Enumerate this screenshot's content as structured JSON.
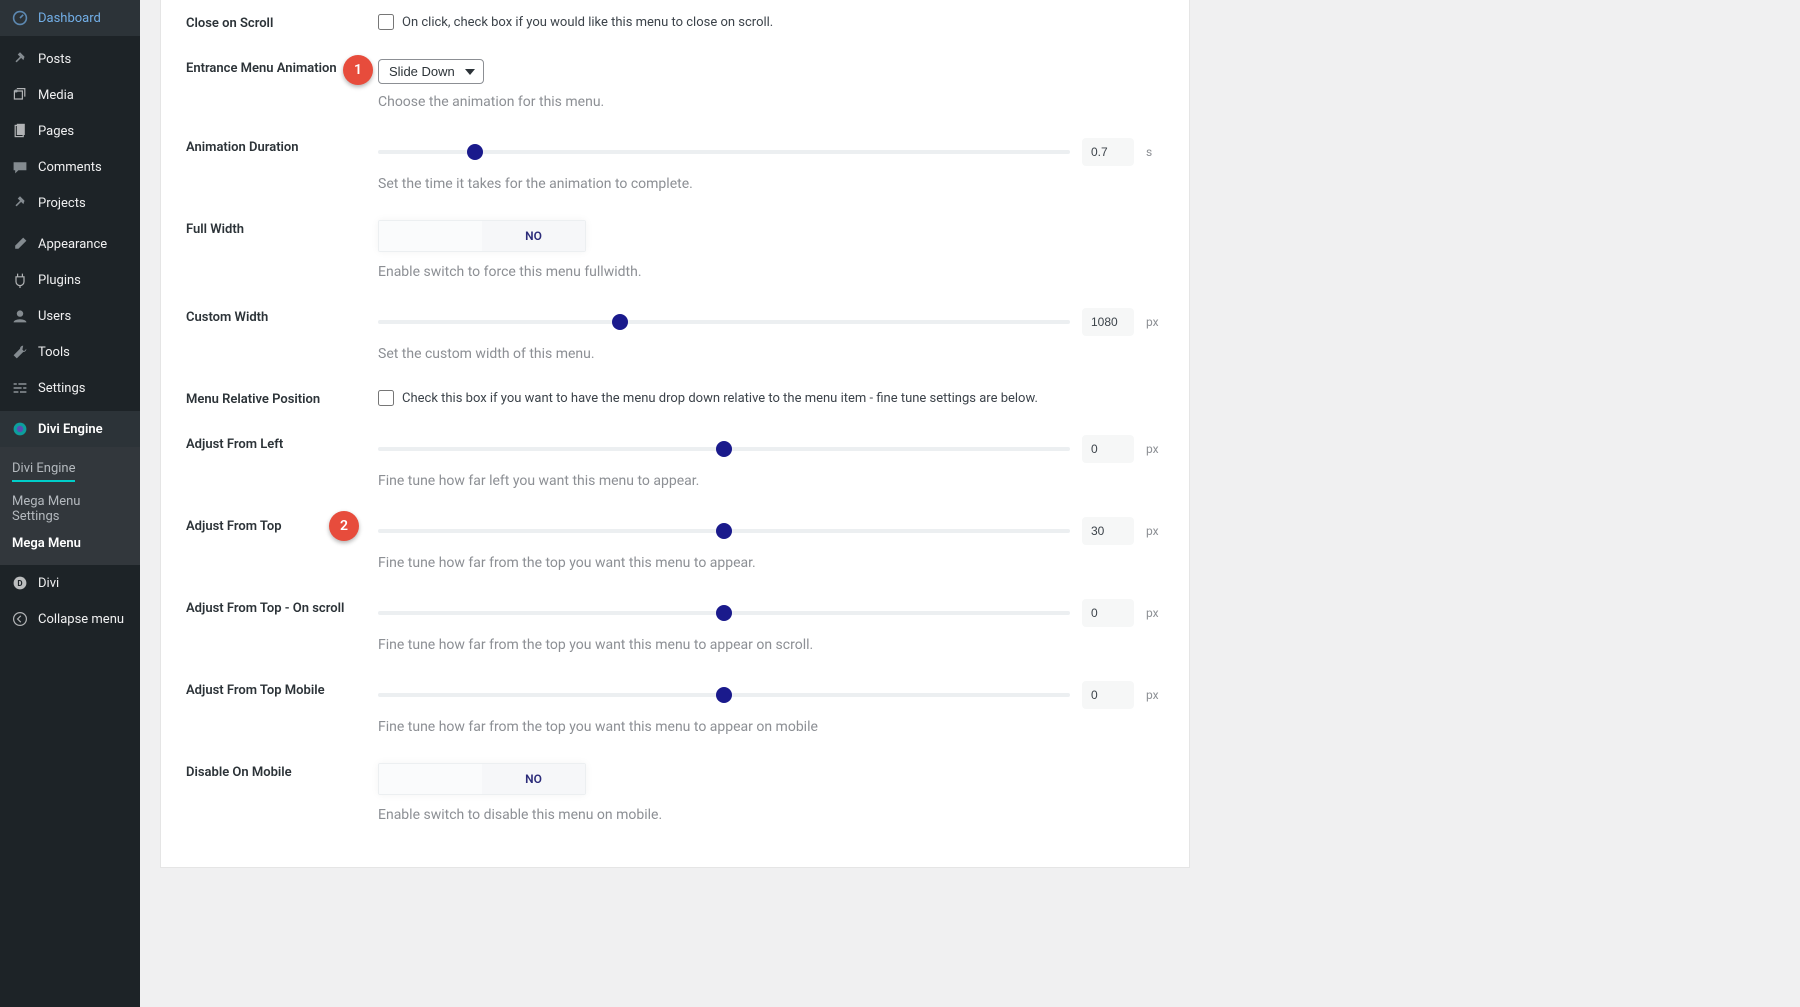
{
  "sidebar": {
    "items": [
      {
        "label": "Dashboard",
        "icon": "dashboard"
      },
      {
        "label": "Posts",
        "icon": "pin"
      },
      {
        "label": "Media",
        "icon": "media"
      },
      {
        "label": "Pages",
        "icon": "pages"
      },
      {
        "label": "Comments",
        "icon": "comments"
      },
      {
        "label": "Projects",
        "icon": "pin"
      },
      {
        "label": "Appearance",
        "icon": "brush"
      },
      {
        "label": "Plugins",
        "icon": "plug"
      },
      {
        "label": "Users",
        "icon": "users"
      },
      {
        "label": "Tools",
        "icon": "tools"
      },
      {
        "label": "Settings",
        "icon": "settings"
      }
    ],
    "divi_engine": {
      "label": "Divi Engine"
    },
    "submenu": [
      {
        "label": "Divi Engine"
      },
      {
        "label": "Mega Menu Settings"
      },
      {
        "label": "Mega Menu"
      }
    ],
    "divi": {
      "label": "Divi"
    },
    "collapse": {
      "label": "Collapse menu"
    }
  },
  "fields": {
    "close_on_scroll": {
      "label": "Close on Scroll",
      "desc": "On click, check box if you would like this menu to close on scroll."
    },
    "animation": {
      "label": "Entrance Menu Animation",
      "value": "Slide Down",
      "desc": "Choose the animation for this menu."
    },
    "duration": {
      "label": "Animation Duration",
      "value": "0.7",
      "unit": "s",
      "desc": "Set the time it takes for the animation to complete.",
      "pct": 14
    },
    "full_width": {
      "label": "Full Width",
      "value": "NO",
      "desc": "Enable switch to force this menu fullwidth."
    },
    "custom_width": {
      "label": "Custom Width",
      "value": "1080",
      "unit": "px",
      "desc": "Set the custom width of this menu.",
      "pct": 35
    },
    "relative_pos": {
      "label": "Menu Relative Position",
      "desc": "Check this box if you want to have the menu drop down relative to the menu item - fine tune settings are below."
    },
    "adjust_left": {
      "label": "Adjust From Left",
      "value": "0",
      "unit": "px",
      "desc": "Fine tune how far left you want this menu to appear.",
      "pct": 50
    },
    "adjust_top": {
      "label": "Adjust From Top",
      "value": "30",
      "unit": "px",
      "desc": "Fine tune how far from the top you want this menu to appear.",
      "pct": 50
    },
    "adjust_top_scroll": {
      "label": "Adjust From Top - On scroll",
      "value": "0",
      "unit": "px",
      "desc": "Fine tune how far from the top you want this menu to appear on scroll.",
      "pct": 50
    },
    "adjust_top_mobile": {
      "label": "Adjust From Top Mobile",
      "value": "0",
      "unit": "px",
      "desc": "Fine tune how far from the top you want this menu to appear on mobile",
      "pct": 50
    },
    "disable_mobile": {
      "label": "Disable On Mobile",
      "value": "NO",
      "desc": "Enable switch to disable this menu on mobile."
    }
  },
  "annotations": {
    "a1": "1",
    "a2": "2"
  }
}
